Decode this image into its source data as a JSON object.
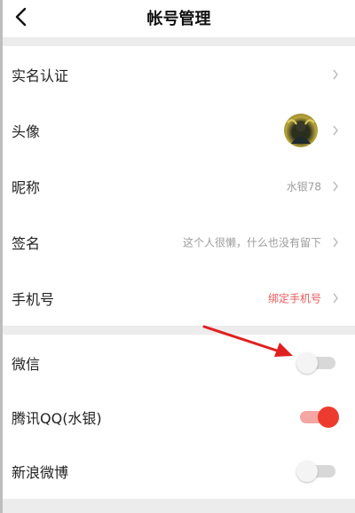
{
  "header": {
    "title": "帐号管理"
  },
  "profile_rows": [
    {
      "label": "实名认证",
      "value": ""
    },
    {
      "label": "头像",
      "value": ""
    },
    {
      "label": "昵称",
      "value": "水银78"
    },
    {
      "label": "签名",
      "value": "这个人很懒，什么也没有留下"
    },
    {
      "label": "手机号",
      "value": "绑定手机号"
    }
  ],
  "social_rows": [
    {
      "label": "微信",
      "enabled": false
    },
    {
      "label": "腾讯QQ(水银)",
      "enabled": true
    },
    {
      "label": "新浪微博",
      "enabled": false
    }
  ],
  "colors": {
    "accent_red": "#ee3b2f",
    "link_red": "#e55a5a",
    "annotation_arrow": "#e02020"
  }
}
